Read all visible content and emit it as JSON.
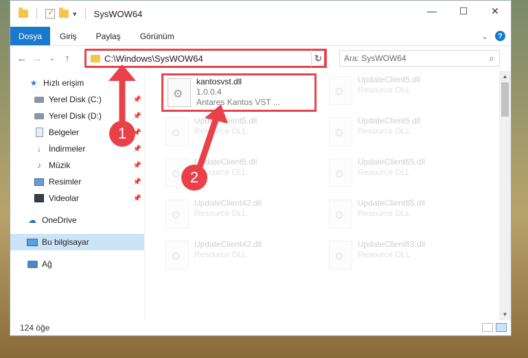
{
  "window": {
    "title": "SysWOW64"
  },
  "window_buttons": {
    "minimize": "—",
    "maximize": "☐",
    "close": "✕"
  },
  "ribbon": {
    "file_tab": "Dosya",
    "tabs": [
      "Giriş",
      "Paylaş",
      "Görünüm"
    ],
    "expand_glyph": "⌄",
    "help_glyph": "?"
  },
  "address": {
    "path": "C:\\Windows\\SysWOW64",
    "refresh_glyph": "↻",
    "dropdown_glyph": "⌄"
  },
  "search": {
    "placeholder": "Ara: SysWOW64",
    "icon": "search-icon"
  },
  "nav": {
    "items": [
      {
        "label": "Hızlı erişim",
        "icon": "star-icon",
        "pinned": false
      },
      {
        "label": "Yerel Disk (C:)",
        "icon": "drive-icon",
        "pinned": true
      },
      {
        "label": "Yerel Disk (D:)",
        "icon": "drive-icon",
        "pinned": true
      },
      {
        "label": "Belgeler",
        "icon": "documents-icon",
        "pinned": true
      },
      {
        "label": "İndirmeler",
        "icon": "download-icon",
        "pinned": true
      },
      {
        "label": "Müzik",
        "icon": "music-icon",
        "pinned": true
      },
      {
        "label": "Resimler",
        "icon": "pictures-icon",
        "pinned": true
      },
      {
        "label": "Videolar",
        "icon": "videos-icon",
        "pinned": true
      },
      {
        "label": "OneDrive",
        "icon": "onedrive-icon",
        "pinned": false
      },
      {
        "label": "Bu bilgisayar",
        "icon": "this-pc-icon",
        "pinned": false,
        "selected": true
      },
      {
        "label": "Ağ",
        "icon": "network-icon",
        "pinned": false
      }
    ]
  },
  "files": {
    "highlighted": {
      "name": "kantosvst.dll",
      "version": "1.0.0.4",
      "description": "Antares Kantos VST ..."
    },
    "faded": [
      {
        "name": "UpdateClient5.dll",
        "type": "Resource DLL"
      },
      {
        "name": "UpdateClient5.dll",
        "type": "Resource DLL"
      },
      {
        "name": "UpdateClient5.dll",
        "type": "Resource DLL"
      },
      {
        "name": "UpdateClient5.dll",
        "type": "Resource DLL"
      },
      {
        "name": "UpdateClient5.dll",
        "type": "Resource DLL"
      },
      {
        "name": "UpdateClient65.dll",
        "type": "Resource DLL"
      },
      {
        "name": "UpdateClient42.dll",
        "type": "Resource DLL"
      },
      {
        "name": "UpdateClient65.dll",
        "type": "Resource DLL"
      },
      {
        "name": "UpdateClient42.dll",
        "type": "Resource DLL"
      },
      {
        "name": "UpdateClient63.dll",
        "type": "Resource DLL"
      }
    ]
  },
  "status": {
    "item_count": "124 öğe"
  },
  "annotations": {
    "callout_1": "1",
    "callout_2": "2",
    "color": "#e8414a"
  }
}
